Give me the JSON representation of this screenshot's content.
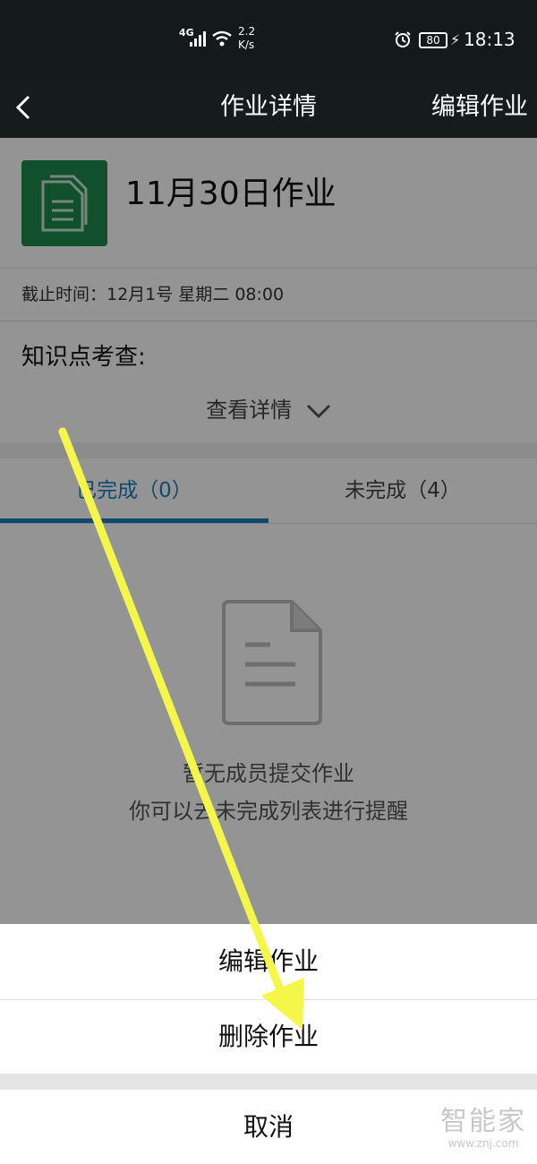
{
  "status_bar": {
    "network": "4G",
    "speed_value": "2.2",
    "speed_unit": "K/s",
    "battery": "80",
    "time": "18:13"
  },
  "nav": {
    "title": "作业详情",
    "edit_label": "编辑作业"
  },
  "homework": {
    "title": "11月30日作业",
    "deadline": "截止时间：12月1号 星期二 08:00",
    "knowledge_label": "知识点考查:",
    "detail_link": "查看详情"
  },
  "tabs": {
    "done": "已完成（0）",
    "undone": "未完成（4）"
  },
  "empty_state": {
    "line1": "暂无成员提交作业",
    "line2": "你可以去未完成列表进行提醒"
  },
  "action_sheet": {
    "edit": "编辑作业",
    "delete": "删除作业",
    "cancel": "取消"
  },
  "watermark": {
    "brand": "智能家",
    "url": "www.znj.com"
  },
  "colors": {
    "accent": "#1a7fc2",
    "icon_green": "#1d8a4c",
    "annotation_arrow": "#f4f74a"
  }
}
